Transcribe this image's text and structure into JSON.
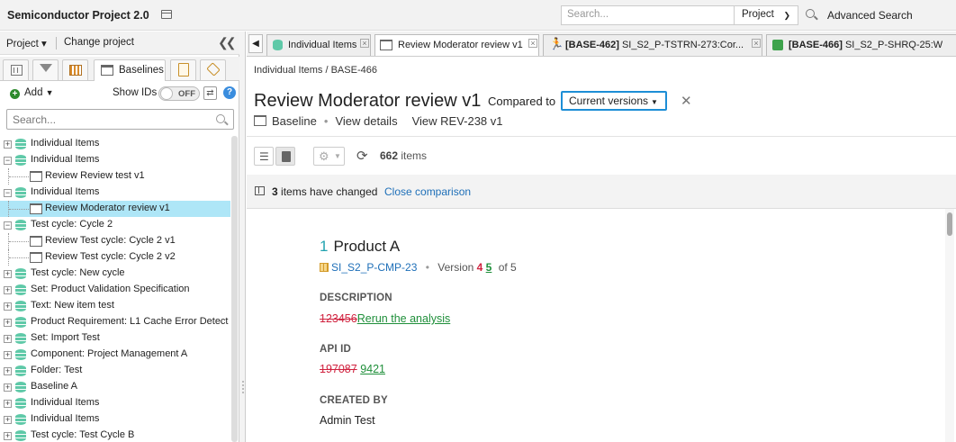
{
  "app": {
    "title": "Semiconductor Project 2.0"
  },
  "search": {
    "placeholder": "Search...",
    "scope": "Project",
    "advanced": "Advanced Search"
  },
  "left": {
    "project_label": "Project ▾",
    "change_project": "Change project",
    "active_tab": "Baselines",
    "add_label": "Add",
    "show_ids": "Show IDs",
    "toggle_state": "OFF",
    "search_placeholder": "Search...",
    "tree": [
      {
        "label": "Individual Items",
        "level": 0,
        "exp": "+",
        "icon": "db"
      },
      {
        "label": "Individual Items",
        "level": 0,
        "exp": "−",
        "icon": "db"
      },
      {
        "label": "Review Review test v1",
        "level": 1,
        "icon": "baseline"
      },
      {
        "label": "Individual Items",
        "level": 0,
        "exp": "−",
        "icon": "db"
      },
      {
        "label": "Review Moderator review v1",
        "level": 1,
        "icon": "baseline",
        "selected": true
      },
      {
        "label": "Test cycle: Cycle 2",
        "level": 0,
        "exp": "−",
        "icon": "db"
      },
      {
        "label": "Review Test cycle: Cycle 2 v1",
        "level": 1,
        "icon": "baseline"
      },
      {
        "label": "Review Test cycle: Cycle 2 v2",
        "level": 1,
        "icon": "baseline"
      },
      {
        "label": "Test cycle: New cycle",
        "level": 0,
        "exp": "+",
        "icon": "db"
      },
      {
        "label": "Set: Product Validation Specification",
        "level": 0,
        "exp": "+",
        "icon": "db"
      },
      {
        "label": "Text: New item test",
        "level": 0,
        "exp": "+",
        "icon": "db"
      },
      {
        "label": "Product Requirement: L1 Cache Error Detect",
        "level": 0,
        "exp": "+",
        "icon": "db"
      },
      {
        "label": "Set: Import Test",
        "level": 0,
        "exp": "+",
        "icon": "db"
      },
      {
        "label": "Component: Project Management A",
        "level": 0,
        "exp": "+",
        "icon": "db"
      },
      {
        "label": "Folder: Test",
        "level": 0,
        "exp": "+",
        "icon": "db"
      },
      {
        "label": "Baseline A",
        "level": 0,
        "exp": "+",
        "icon": "db"
      },
      {
        "label": "Individual Items",
        "level": 0,
        "exp": "+",
        "icon": "db"
      },
      {
        "label": "Individual Items",
        "level": 0,
        "exp": "+",
        "icon": "db"
      },
      {
        "label": "Test cycle: Test Cycle B",
        "level": 0,
        "exp": "+",
        "icon": "db"
      }
    ]
  },
  "tabs": [
    {
      "label": "Individual Items",
      "icon": "db"
    },
    {
      "label": "Review Moderator review v1",
      "icon": "baseline",
      "active": true
    },
    {
      "label_bold": "[BASE-462]",
      "label": " SI_S2_P-TSTRN-273:Cor...",
      "icon": "run"
    },
    {
      "label_bold": "[BASE-466]",
      "label": " SI_S2_P-SHRQ-25:W",
      "icon": "puzzle"
    }
  ],
  "page": {
    "breadcrumb": "Individual Items / BASE-466",
    "title": "Review Moderator review v1",
    "compared_to": "Compared to",
    "compared_select": "Current versions",
    "subnav": {
      "baseline": "Baseline",
      "view_details": "View details",
      "view_rev": "View REV-238 v1"
    },
    "count_num": "662",
    "count_label": "items",
    "changed_num": "3",
    "changed_text": "items have changed",
    "close_comparison": "Close comparison"
  },
  "item": {
    "number": "1",
    "name": "Product A",
    "key": "SI_S2_P-CMP-23",
    "version_label": "Version",
    "version_old": "4",
    "version_new": "5",
    "version_of": "of 5",
    "fields": [
      {
        "label": "DESCRIPTION",
        "old": "123456",
        "new": "Rerun the analysis"
      },
      {
        "label": "API ID",
        "old": "197087",
        "new": "9421"
      },
      {
        "label": "CREATED BY",
        "value": "Admin Test"
      }
    ]
  },
  "colors": {
    "accent": "#1d8ed6",
    "selected_row": "#aee6f7",
    "deleted": "#d0213e",
    "inserted": "#1f8f3a",
    "link": "#1e6fb8"
  }
}
